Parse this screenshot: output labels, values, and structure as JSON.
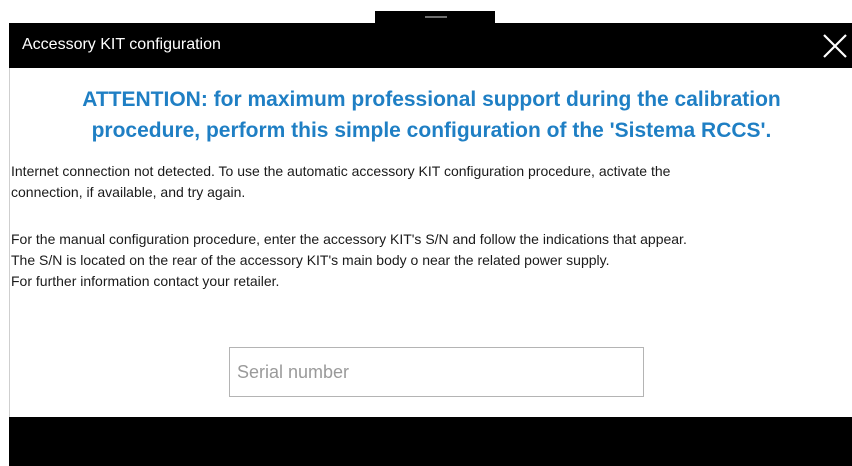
{
  "window": {
    "title": "Accessory KIT configuration",
    "close_icon": "close-icon"
  },
  "attention": {
    "line1": "ATTENTION: for maximum professional support during the calibration",
    "line2": "procedure, perform this simple configuration of the 'Sistema RCCS'."
  },
  "message": {
    "p1_line1": "Internet connection not detected. To use the automatic accessory KIT configuration procedure, activate the",
    "p1_line2": "connection, if available, and try again.",
    "p2_line1": "For the manual configuration procedure, enter the accessory KIT's S/N and follow the indications that appear.",
    "p2_line2": "The S/N is located on the rear of the accessory KIT's main body o near the related power supply.",
    "p2_line3": "For further information contact your retailer."
  },
  "serial": {
    "value": "",
    "placeholder": "Serial number"
  },
  "colors": {
    "accent": "#1f7fc4",
    "titlebar": "#000000",
    "background": "#ffffff"
  }
}
